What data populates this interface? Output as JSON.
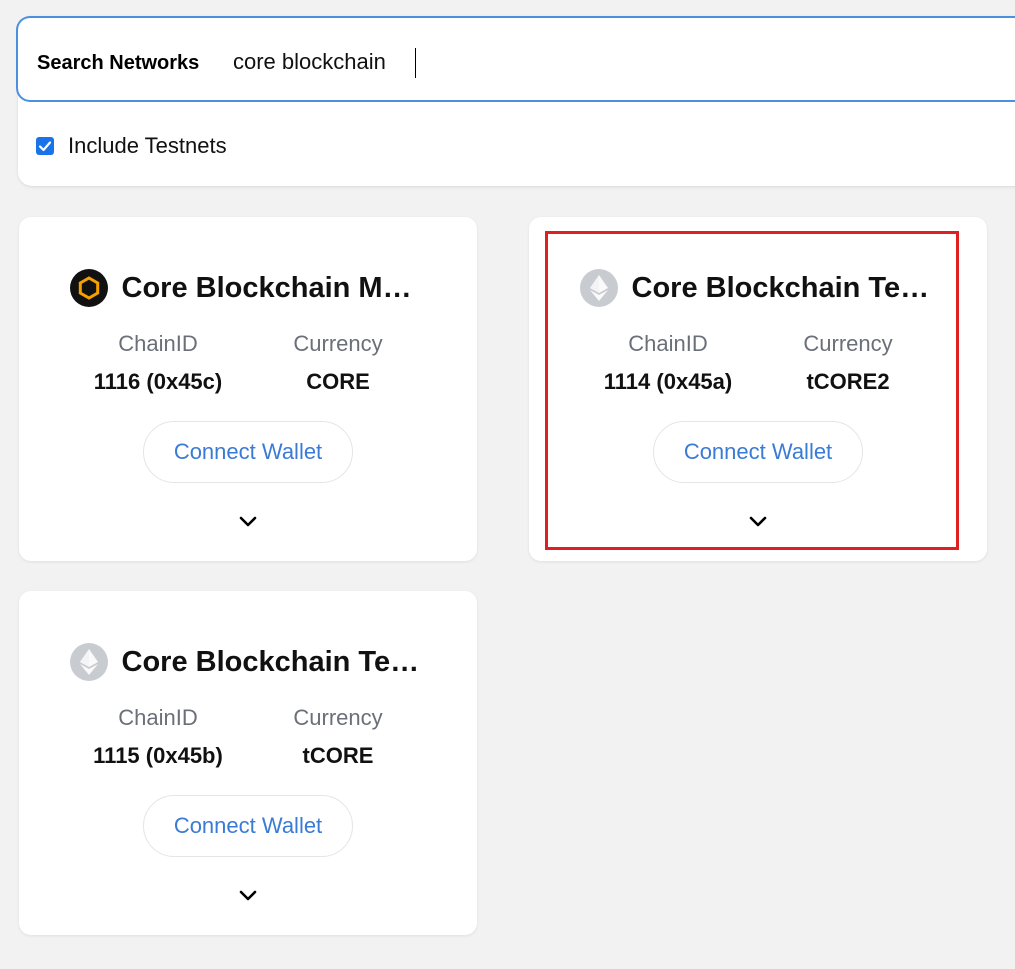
{
  "search": {
    "label": "Search Networks",
    "value": "core blockchain"
  },
  "filters": {
    "include_testnets_label": "Include Testnets",
    "include_testnets_checked": true
  },
  "networks": [
    {
      "title": "Core Blockchain Mai...",
      "icon": "core-hexagon-icon",
      "chain_id_label": "ChainID",
      "chain_id": "1116 (0x45c)",
      "currency_label": "Currency",
      "currency": "CORE",
      "connect_label": "Connect Wallet"
    },
    {
      "title": "Core Blockchain Test...",
      "icon": "ethereum-icon",
      "chain_id_label": "ChainID",
      "chain_id": "1114 (0x45a)",
      "currency_label": "Currency",
      "currency": "tCORE2",
      "connect_label": "Connect Wallet",
      "highlighted": true
    },
    {
      "title": "Core Blockchain Test...",
      "icon": "ethereum-icon",
      "chain_id_label": "ChainID",
      "chain_id": "1115 (0x45b)",
      "currency_label": "Currency",
      "currency": "tCORE",
      "connect_label": "Connect Wallet"
    }
  ],
  "colors": {
    "accent": "#3a7bd5",
    "checkbox": "#1a73e8",
    "highlight": "#e02020",
    "core_icon_ring": "#f5a000"
  }
}
